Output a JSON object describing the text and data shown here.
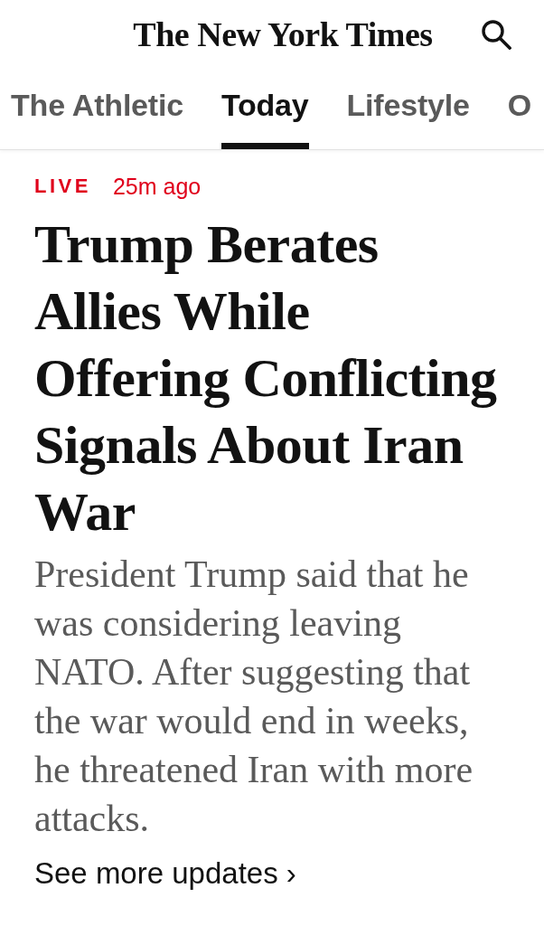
{
  "header": {
    "logo": "The New York Times"
  },
  "tabs": [
    {
      "label": "The Athletic",
      "selected": false
    },
    {
      "label": "Today",
      "selected": true
    },
    {
      "label": "Lifestyle",
      "selected": false
    },
    {
      "label": "O",
      "selected": false
    }
  ],
  "story": {
    "live_label": "LIVE",
    "timestamp": "25m ago",
    "headline": "Trump Berates Allies While Offering Conflicting Signals About Iran War",
    "summary": "President Trump said that he was considering leaving NATO. After suggesting that the war would end in weeks, he threatened Iran with more attacks.",
    "link": "See more updates ›"
  }
}
